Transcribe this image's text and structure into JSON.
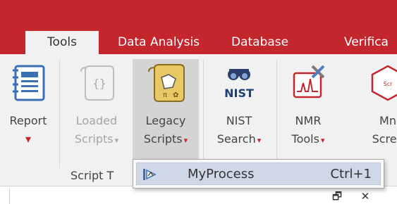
{
  "tabs": [
    {
      "label": "Tools",
      "active": true
    },
    {
      "label": "Data Analysis",
      "active": false
    },
    {
      "label": "Database",
      "active": false
    },
    {
      "label": "Verifica",
      "active": false
    }
  ],
  "commands": [
    {
      "id": "report",
      "line1": "Report",
      "line2": "",
      "icon": "report-icon",
      "enabled": true
    },
    {
      "id": "loaded-scripts",
      "line1": "Loaded",
      "line2": "Scripts",
      "icon": "scroll-icon",
      "enabled": false
    },
    {
      "id": "legacy-scripts",
      "line1": "Legacy",
      "line2": "Scripts",
      "icon": "legacy-scroll-icon",
      "enabled": true,
      "pressed": true
    },
    {
      "id": "nist-search",
      "line1": "NIST",
      "line2": "Search",
      "icon": "nist-icon",
      "enabled": true
    },
    {
      "id": "nmr-tools",
      "line1": "NMR",
      "line2": "Tools",
      "icon": "nmr-tools-icon",
      "enabled": true
    },
    {
      "id": "mn-screen",
      "line1": "Mn",
      "line2": "Scree",
      "icon": "script-hex-icon",
      "enabled": true
    }
  ],
  "group_label": "Script T",
  "popup": {
    "item_label": "MyProcess",
    "shortcut": "Ctrl+1",
    "icon": "process-icon"
  },
  "window_buttons": {
    "restore": "🗗",
    "close": "✕"
  },
  "colors": {
    "ribbon_red": "#c4262e",
    "ribbon_bg": "#f1f1f1",
    "popup_highlight": "#cfd8e6"
  }
}
